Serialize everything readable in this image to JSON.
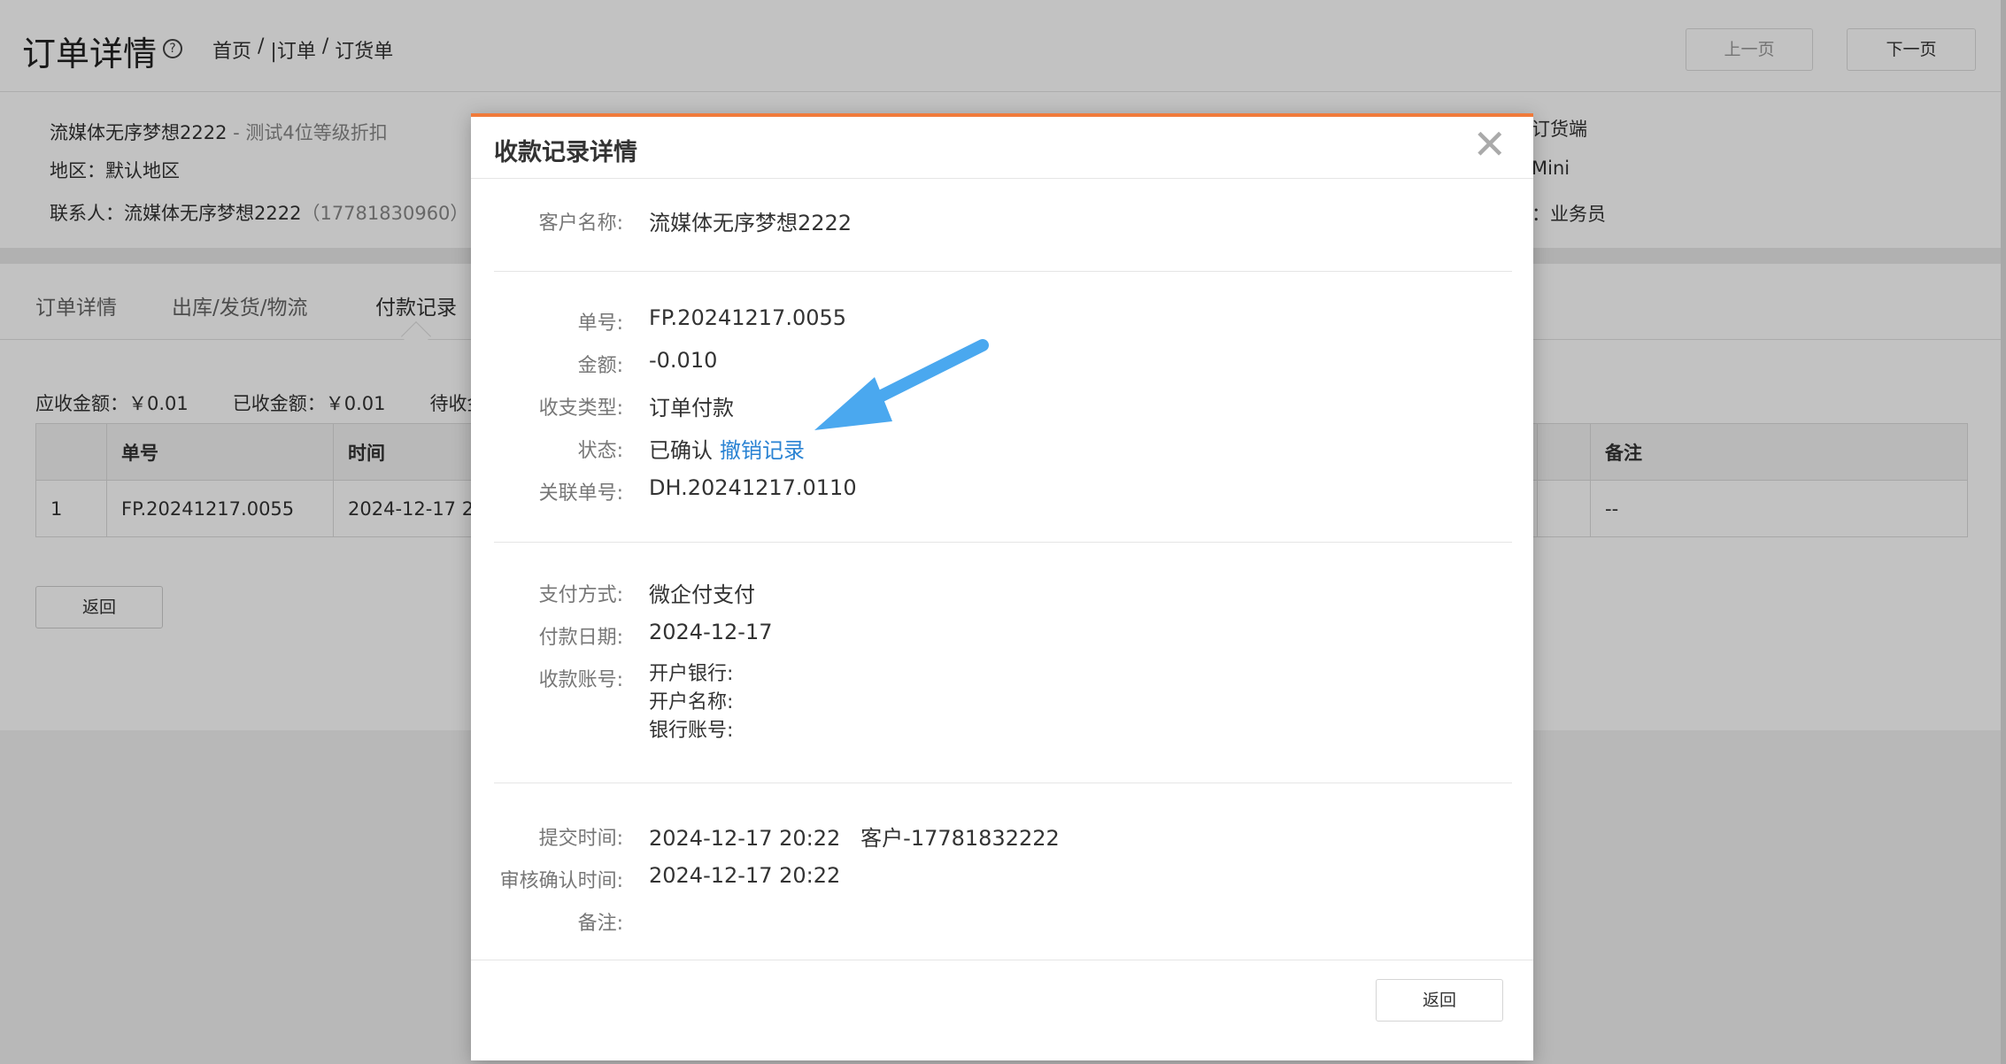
{
  "header": {
    "title": "订单详情",
    "help_glyph": "?",
    "breadcrumb": [
      "首页",
      " / ",
      "|订单",
      " / ",
      "订货单"
    ],
    "prev_label": "上一页",
    "next_label": "下一页"
  },
  "info": {
    "customer": "流媒体无序梦想2222",
    "customer_suffix": " - 测试4位等级折扣",
    "region": "地区：默认地区",
    "contact_label": "联系人：",
    "contact_name": "流媒体无序梦想2222",
    "contact_phone": "（17781830960）",
    "right_line1": "订货端",
    "right_line2": "Mini",
    "right_line3": "：业务员"
  },
  "tabs": [
    "订单详情",
    "出库/发货/物流",
    "付款记录"
  ],
  "payment": {
    "receivable": "应收金额：￥0.01",
    "received": "已收金额：￥0.01",
    "pending": "待收金",
    "columns": [
      "",
      "单号",
      "时间",
      "",
      "备注"
    ],
    "rows": [
      {
        "index": "1",
        "number": "FP.20241217.0055",
        "time": "2024-12-17 2",
        "extra": "",
        "remark": "--"
      }
    ],
    "back_label": "返回"
  },
  "modal": {
    "title": "收款记录详情",
    "close_glyph": "✕",
    "customer_label": "客户名称:",
    "customer_value": "流媒体无序梦想2222",
    "number_label": "单号:",
    "number_value": "FP.20241217.0055",
    "amount_label": "金额:",
    "amount_value": "-0.010",
    "type_label": "收支类型:",
    "type_value": "订单付款",
    "status_label": "状态:",
    "status_value": "已确认",
    "status_link": "撤销记录",
    "related_label": "关联单号:",
    "related_value": "DH.20241217.0110",
    "method_label": "支付方式:",
    "method_value": "微企付支付",
    "paydate_label": "付款日期:",
    "paydate_value": "2024-12-17",
    "account_label": "收款账号:",
    "account_bank": "开户银行:",
    "account_name": "开户名称:",
    "account_no": "银行账号:",
    "submit_label": "提交时间:",
    "submit_value": "2024-12-17 20:22   客户-17781832222",
    "audit_label": "审核确认时间:",
    "audit_value": "2024-12-17 20:22",
    "remark_label": "备注:",
    "back_label": "返回"
  },
  "colors": {
    "accent_top": "#f07a3a",
    "link": "#2a83d3",
    "arrow": "#4aa8ef"
  },
  "arrow_icon": "arrow-annotation-icon"
}
